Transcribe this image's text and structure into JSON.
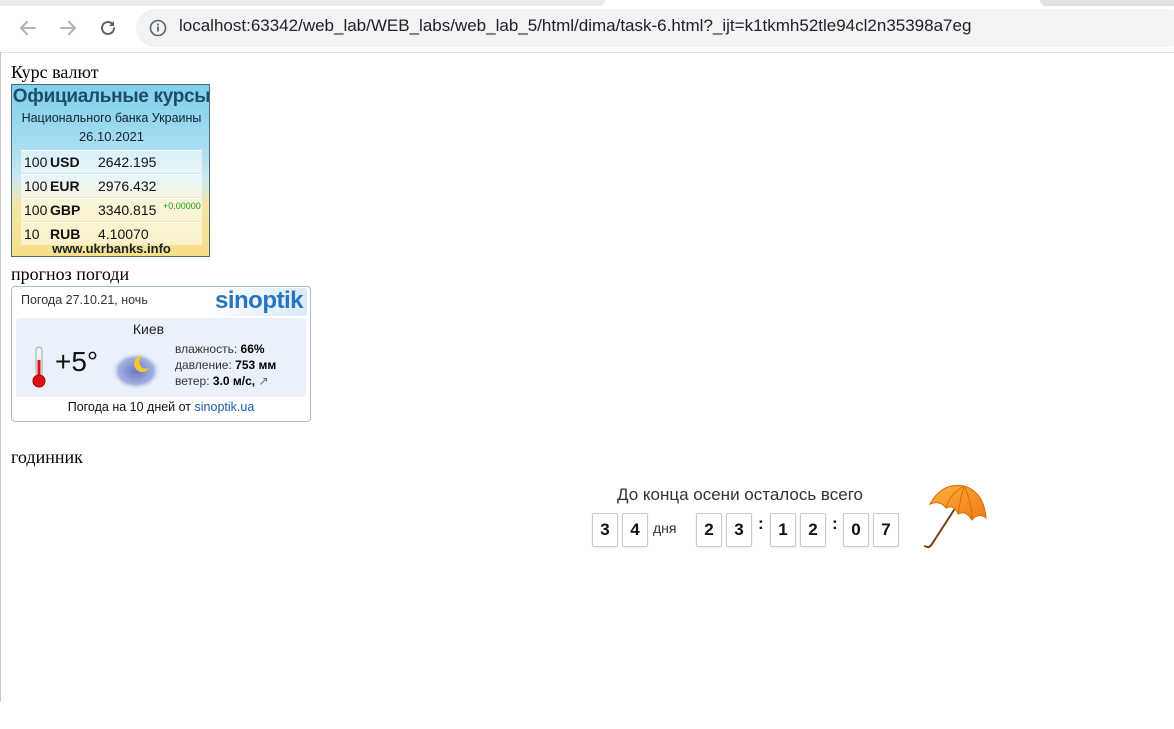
{
  "browser": {
    "url": "localhost:63342/web_lab/WEB_labs/web_lab_5/html/dima/task-6.html?_ijt=k1tkmh52tle94cl2n35398a7eg",
    "back_icon": "arrow-left-icon",
    "forward_icon": "arrow-right-icon",
    "reload_icon": "reload-icon",
    "info_icon": "info-circle-icon"
  },
  "sections": {
    "currency_label": "Курс валют",
    "weather_label": "прогноз погоди",
    "clock_label": "годинник"
  },
  "currency_widget": {
    "title": "Официальные курсы",
    "subtitle": "Национального банка Украины",
    "date": "26.10.2021",
    "rows": [
      {
        "amount": "100",
        "code": "USD",
        "rate": "2642.195",
        "change": ""
      },
      {
        "amount": "100",
        "code": "EUR",
        "rate": "2976.432",
        "change": ""
      },
      {
        "amount": "100",
        "code": "GBP",
        "rate": "3340.815",
        "change": "+0.00000"
      },
      {
        "amount": "10",
        "code": "RUB",
        "rate": "4.10070",
        "change": ""
      }
    ],
    "footer": "www.ukrbanks.info"
  },
  "weather_widget": {
    "header": "Погода 27.10.21, ночь",
    "logo": "sinoptik",
    "city": "Киев",
    "temperature": "+5°",
    "humidity_label": "влажность:",
    "humidity": "66%",
    "pressure_label": "давление:",
    "pressure": "753 мм",
    "wind_label": "ветер:",
    "wind": "3.0 м/с,",
    "wind_arrow": "↗",
    "footer_text": "Погода на 10 дней от",
    "footer_link": "sinoptik.ua"
  },
  "countdown": {
    "title": "До конца осени осталось всего",
    "days_digits": [
      "3",
      "4"
    ],
    "days_label": "дня",
    "hours_digits": [
      "2",
      "3"
    ],
    "minutes_digits": [
      "1",
      "2"
    ],
    "seconds_digits": [
      "0",
      "7"
    ],
    "separator": ":"
  }
}
